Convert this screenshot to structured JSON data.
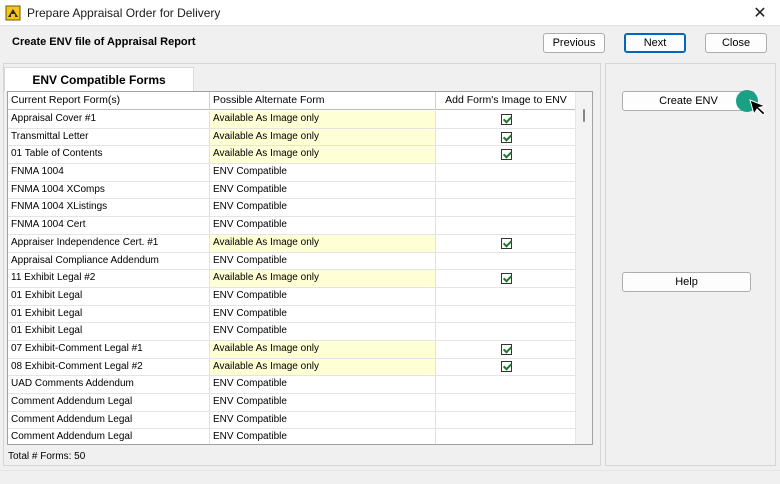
{
  "window": {
    "title": "Prepare Appraisal Order for Delivery",
    "close_glyph": "✕"
  },
  "header": {
    "subtitle": "Create ENV file of Appraisal Report",
    "previous_label": "Previous",
    "next_label": "Next",
    "close_label": "Close"
  },
  "tabs": {
    "active_label": "ENV Compatible Forms"
  },
  "grid": {
    "columns": [
      "Current Report Form(s)",
      "Possible Alternate Form",
      "Add Form's Image to ENV"
    ],
    "rows": [
      {
        "form": "Appraisal Cover #1",
        "alt": "Available As Image only",
        "checked": true
      },
      {
        "form": "Transmittal Letter",
        "alt": "Available As Image only",
        "checked": true
      },
      {
        "form": "01 Table of Contents",
        "alt": "Available As Image only",
        "checked": true
      },
      {
        "form": "FNMA 1004",
        "alt": "ENV Compatible",
        "checked": false
      },
      {
        "form": "FNMA 1004 XComps",
        "alt": "ENV Compatible",
        "checked": false
      },
      {
        "form": "FNMA 1004 XListings",
        "alt": "ENV Compatible",
        "checked": false
      },
      {
        "form": "FNMA 1004 Cert",
        "alt": "ENV Compatible",
        "checked": false
      },
      {
        "form": "Appraiser Independence Cert. #1",
        "alt": "Available As Image only",
        "checked": true
      },
      {
        "form": "Appraisal Compliance Addendum",
        "alt": "ENV Compatible",
        "checked": false
      },
      {
        "form": "11 Exhibit Legal #2",
        "alt": "Available As Image only",
        "checked": true
      },
      {
        "form": "01 Exhibit Legal",
        "alt": "ENV Compatible",
        "checked": false
      },
      {
        "form": "01 Exhibit Legal",
        "alt": "ENV Compatible",
        "checked": false
      },
      {
        "form": "01 Exhibit Legal",
        "alt": "ENV Compatible",
        "checked": false
      },
      {
        "form": "07 Exhibit-Comment Legal #1",
        "alt": "Available As Image only",
        "checked": true
      },
      {
        "form": "08 Exhibit-Comment Legal #2",
        "alt": "Available As Image only",
        "checked": true
      },
      {
        "form": "UAD Comments Addendum",
        "alt": "ENV Compatible",
        "checked": false
      },
      {
        "form": "Comment Addendum Legal",
        "alt": "ENV Compatible",
        "checked": false
      },
      {
        "form": "Comment Addendum Legal",
        "alt": "ENV Compatible",
        "checked": false
      },
      {
        "form": "Comment Addendum Legal",
        "alt": "ENV Compatible",
        "checked": false
      }
    ],
    "total_label": "Total # Forms: 50"
  },
  "actions": {
    "create_env_label": "Create ENV",
    "help_label": "Help"
  },
  "colors": {
    "image_only_highlight": "#ffffd5",
    "primary_border": "#0067c0",
    "cursor_highlight": "#1aa084"
  }
}
